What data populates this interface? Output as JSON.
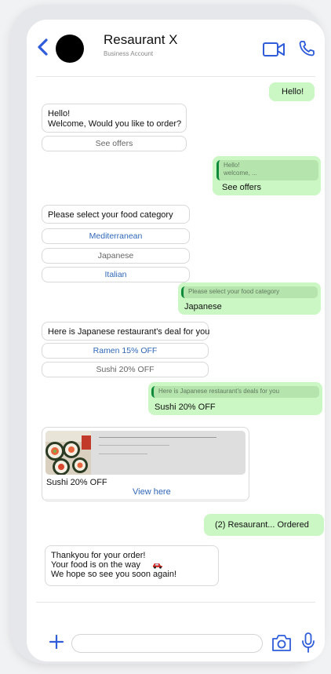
{
  "header": {
    "title": "Resaurant X",
    "subtitle": "Business Account",
    "back_icon": "chevron-left-icon",
    "video_icon": "video-camera-icon",
    "phone_icon": "phone-icon"
  },
  "messages": {
    "out1": "Hello!",
    "in1_line1": "Hello!",
    "in1_line2": "Welcome, Would you like to order?",
    "see_offers_btn": "See offers",
    "out2_quote_line1": "Hello!",
    "out2_quote_line2": "welcome, ...",
    "out2_text": "See offers",
    "in2_text": "Please select your food category",
    "cat1": "Mediterranean",
    "cat2": "Japanese",
    "cat3": "Italian",
    "out3_quote": "Please select your food category",
    "out3_text": "Japanese",
    "in3_text": "Here is Japanese restaurant's deal for you",
    "deal1": "Ramen 15% OFF",
    "deal2": "Sushi 20% OFF",
    "out4_quote": "Here is Japanese restaurant's deals for you",
    "out4_text": "Sushi 20% OFF",
    "card_title": "Sushi 20% OFF",
    "card_link": "View here",
    "out5_text": "(2) Resaurant... Ordered",
    "thanks_line1": "Thankyou for your order!",
    "thanks_line2": "Your food is on the way",
    "thanks_line3": "We hope so see you soon again!"
  },
  "composer": {
    "placeholder": "",
    "add_icon": "plus-icon",
    "camera_icon": "camera-icon",
    "mic_icon": "microphone-icon"
  },
  "colors": {
    "accent": "#2f5cd9",
    "outgoing": "#cbf7c4",
    "quote_bar": "#0f8a3b",
    "option_blue": "#2f67b8"
  }
}
